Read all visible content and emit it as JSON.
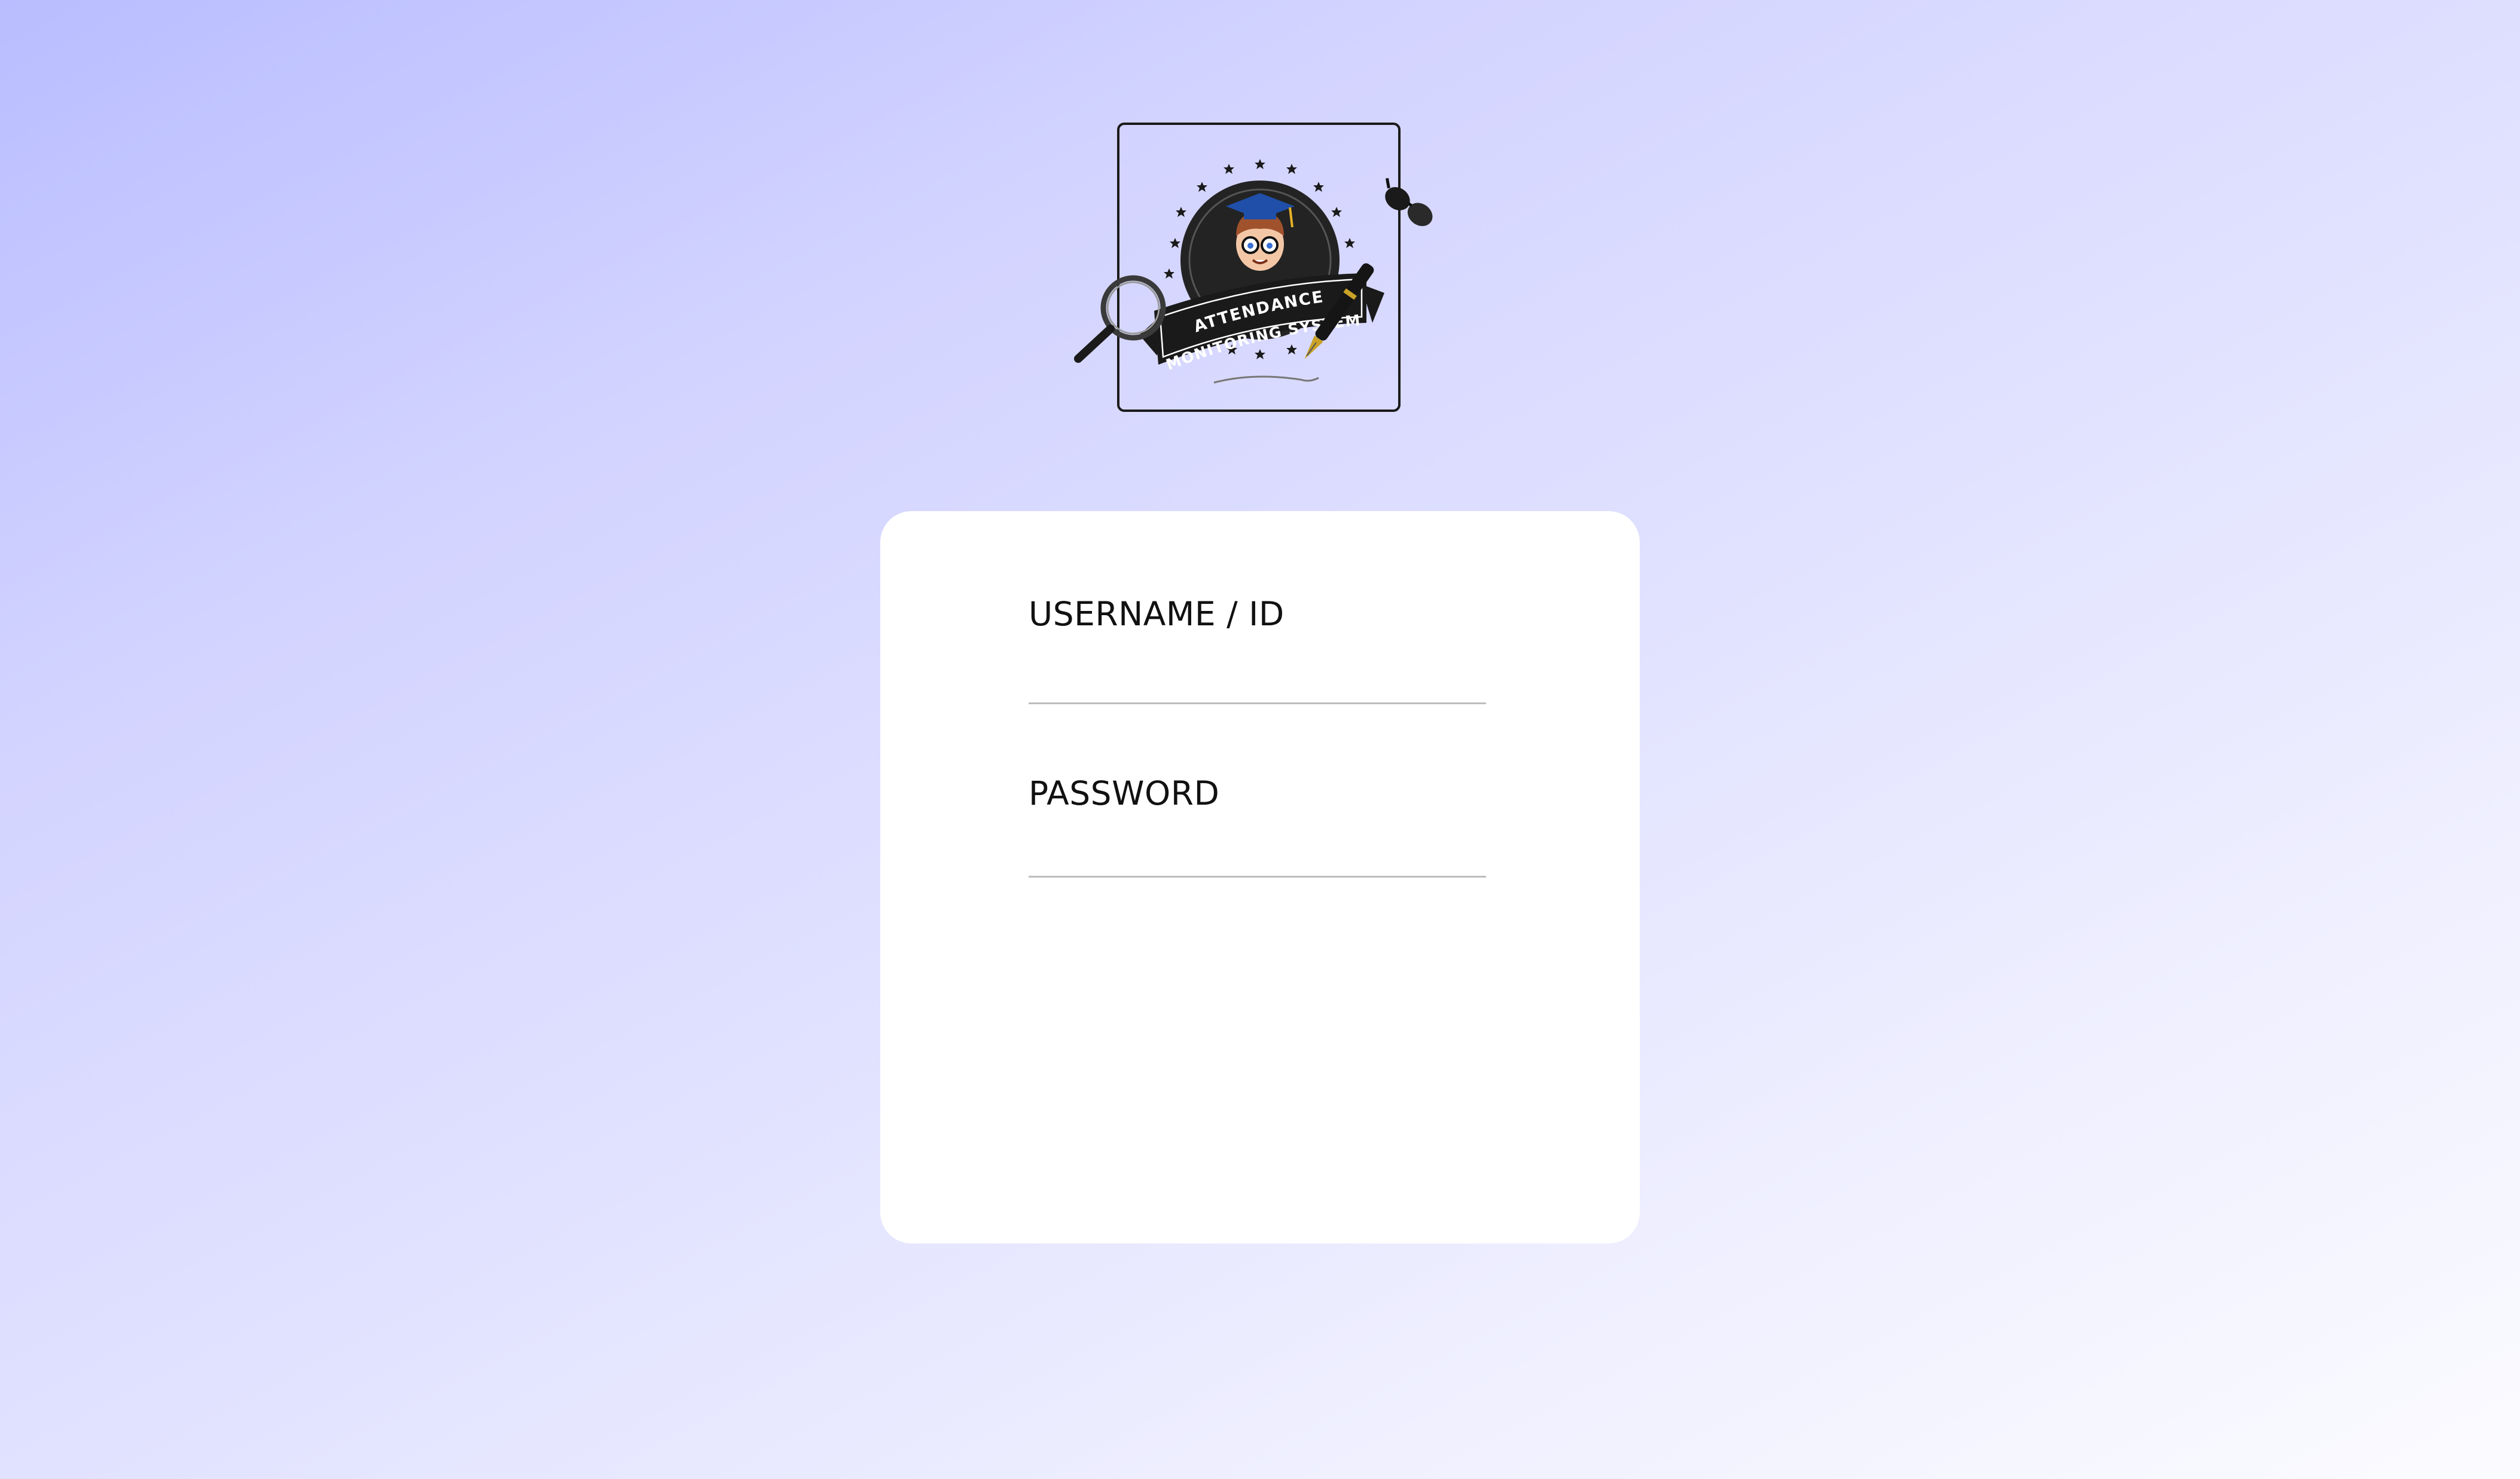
{
  "logo": {
    "line1": "ATTENDANCE",
    "line2": "MONITORING SYSTEM",
    "icons": [
      "graduate-avatar-icon",
      "magnifier-icon",
      "sunglasses-icon",
      "fountain-pen-icon",
      "stars-ring-icon"
    ]
  },
  "login": {
    "username_label": "USERNAME / ID",
    "username_value": "",
    "password_label": "PASSWORD",
    "password_value": ""
  },
  "colors": {
    "background_start": "#b9bdff",
    "background_end": "#fbfbff",
    "card": "#ffffff",
    "badge": "#232323",
    "underline": "#bdbdbd"
  }
}
